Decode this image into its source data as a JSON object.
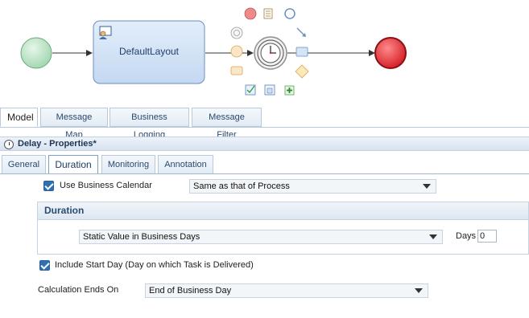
{
  "canvas": {
    "task_label": "DefaultLayout"
  },
  "model_tabs": [
    {
      "label": "Model"
    },
    {
      "label": "Message Map"
    },
    {
      "label": "Business Logging"
    },
    {
      "label": "Message Filter"
    }
  ],
  "properties_panel": {
    "title": "Delay - Properties*"
  },
  "property_tabs": [
    {
      "label": "General"
    },
    {
      "label": "Duration"
    },
    {
      "label": "Monitoring"
    },
    {
      "label": "Annotation"
    }
  ],
  "form": {
    "use_business_calendar_label": "Use Business Calendar",
    "use_business_calendar_checked": true,
    "calendar_select_value": "Same as that of Process",
    "duration_section_title": "Duration",
    "duration_type_select_value": "Static Value in Business Days",
    "days_label": "Days",
    "days_value": "0",
    "include_start_day_label": "Include Start Day (Day on which Task is Delivered)",
    "include_start_day_checked": true,
    "calculation_ends_label": "Calculation Ends On",
    "calculation_ends_value": "End of Business Day"
  },
  "colors": {
    "start_event": "#a9dcb5",
    "end_event": "#e0222a",
    "task_fill": "#cfe0f5",
    "accent": "#2f6fb6"
  }
}
